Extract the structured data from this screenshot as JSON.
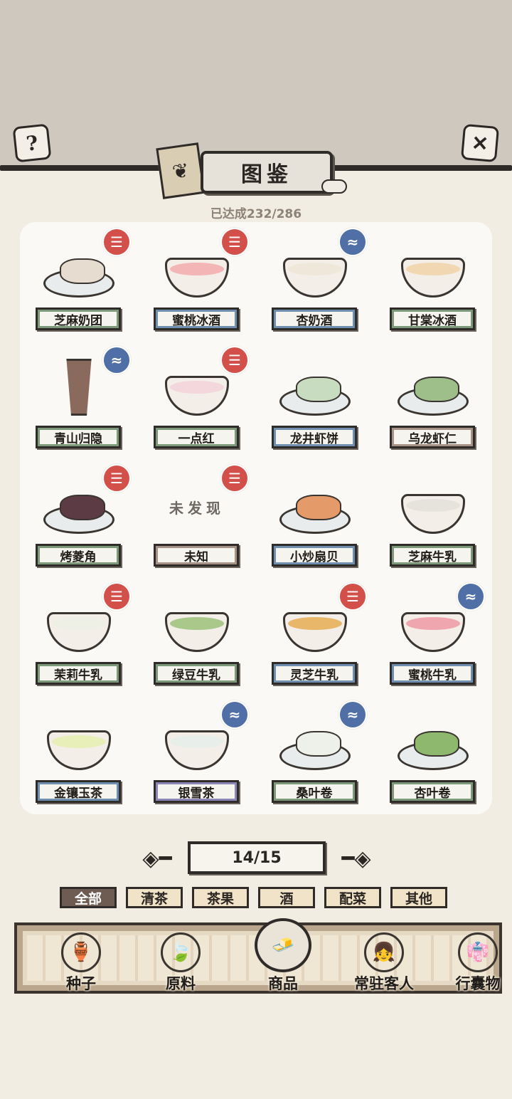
{
  "header": {
    "help_icon": "question-icon",
    "close_icon": "close-x-icon",
    "title": "图鉴",
    "progress": "已达成232/286"
  },
  "items": [
    {
      "name": "芝麻奶团",
      "stamp": "red",
      "label_color": "#7c9a7a",
      "dish": "plate",
      "color": "#e6ddd0"
    },
    {
      "name": "蜜桃冰酒",
      "stamp": "red",
      "label_color": "#6f8fae",
      "dish": "bowl",
      "color": "#f3b5b5"
    },
    {
      "name": "杏奶酒",
      "stamp": "blue",
      "label_color": "#6f8fae",
      "dish": "bowl",
      "color": "#efe8da"
    },
    {
      "name": "甘棠冰酒",
      "stamp": "",
      "label_color": "#7c9a7a",
      "dish": "bowl",
      "color": "#f1d8b2"
    },
    {
      "name": "青山归隐",
      "stamp": "blue",
      "label_color": "#7c9a7a",
      "dish": "tower",
      "color": "#8a6a5c"
    },
    {
      "name": "一点红",
      "stamp": "red",
      "label_color": "#7c9a7a",
      "dish": "bowl",
      "color": "#f4d6dd"
    },
    {
      "name": "龙井虾饼",
      "stamp": "",
      "label_color": "#6f8fae",
      "dish": "plate",
      "color": "#c8dcc0"
    },
    {
      "name": "乌龙虾仁",
      "stamp": "",
      "label_color": "#a79386",
      "dish": "plate",
      "color": "#9fbf8a"
    },
    {
      "name": "烤菱角",
      "stamp": "red",
      "label_color": "#7c9a7a",
      "dish": "plate",
      "color": "#5d3b45"
    },
    {
      "name": "未知",
      "stamp": "red",
      "label_color": "#a79386",
      "dish": "none",
      "color": "",
      "placeholder": "未发现"
    },
    {
      "name": "小炒扇贝",
      "stamp": "",
      "label_color": "#6f8fae",
      "dish": "plate",
      "color": "#e59a6a"
    },
    {
      "name": "芝麻牛乳",
      "stamp": "",
      "label_color": "#7c9a7a",
      "dish": "bowl",
      "color": "#e6e3dd"
    },
    {
      "name": "茉莉牛乳",
      "stamp": "red",
      "label_color": "#7c9a7a",
      "dish": "bowl",
      "color": "#eef0e6"
    },
    {
      "name": "绿豆牛乳",
      "stamp": "",
      "label_color": "#7c9a7a",
      "dish": "bowl",
      "color": "#a9c88a"
    },
    {
      "name": "灵芝牛乳",
      "stamp": "red",
      "label_color": "#6f8fae",
      "dish": "bowl",
      "color": "#e8b76a"
    },
    {
      "name": "蜜桃牛乳",
      "stamp": "blue",
      "label_color": "#6f8fae",
      "dish": "bowl",
      "color": "#f0a6ae"
    },
    {
      "name": "金镶玉茶",
      "stamp": "",
      "label_color": "#6f8fae",
      "dish": "bowl",
      "color": "#e8efb8"
    },
    {
      "name": "银雪茶",
      "stamp": "blue",
      "label_color": "#8b86b5",
      "dish": "bowl",
      "color": "#e8eee9"
    },
    {
      "name": "桑叶卷",
      "stamp": "blue",
      "label_color": "#7c9a7a",
      "dish": "plate",
      "color": "#eef0ea"
    },
    {
      "name": "杏叶卷",
      "stamp": "",
      "label_color": "#7c9a7a",
      "dish": "plate",
      "color": "#8fb86f"
    }
  ],
  "pagination": {
    "current": "14/15",
    "prev_icon": "left-arrow-icon",
    "next_icon": "right-arrow-icon"
  },
  "filters": [
    {
      "label": "全部",
      "active": true
    },
    {
      "label": "清茶",
      "active": false
    },
    {
      "label": "茶果",
      "active": false
    },
    {
      "label": "酒",
      "active": false
    },
    {
      "label": "配菜",
      "active": false
    },
    {
      "label": "其他",
      "active": false
    }
  ],
  "bottom_nav": [
    {
      "label": "种子",
      "icon": "seed-jar-icon",
      "glyph": "🏺",
      "active": false
    },
    {
      "label": "原料",
      "icon": "leaf-icon",
      "glyph": "🍃",
      "active": false
    },
    {
      "label": "商品",
      "icon": "goods-plate-icon",
      "glyph": "🧈",
      "active": true
    },
    {
      "label": "常驻客人",
      "icon": "guest-girl-icon",
      "glyph": "👧",
      "active": false
    },
    {
      "label": "行囊物",
      "icon": "robe-icon",
      "glyph": "👘",
      "active": false
    }
  ],
  "colors": {
    "stamp_red": "#d3504a",
    "stamp_blue": "#4f6fa6",
    "active_filter": "#6e5b52"
  }
}
